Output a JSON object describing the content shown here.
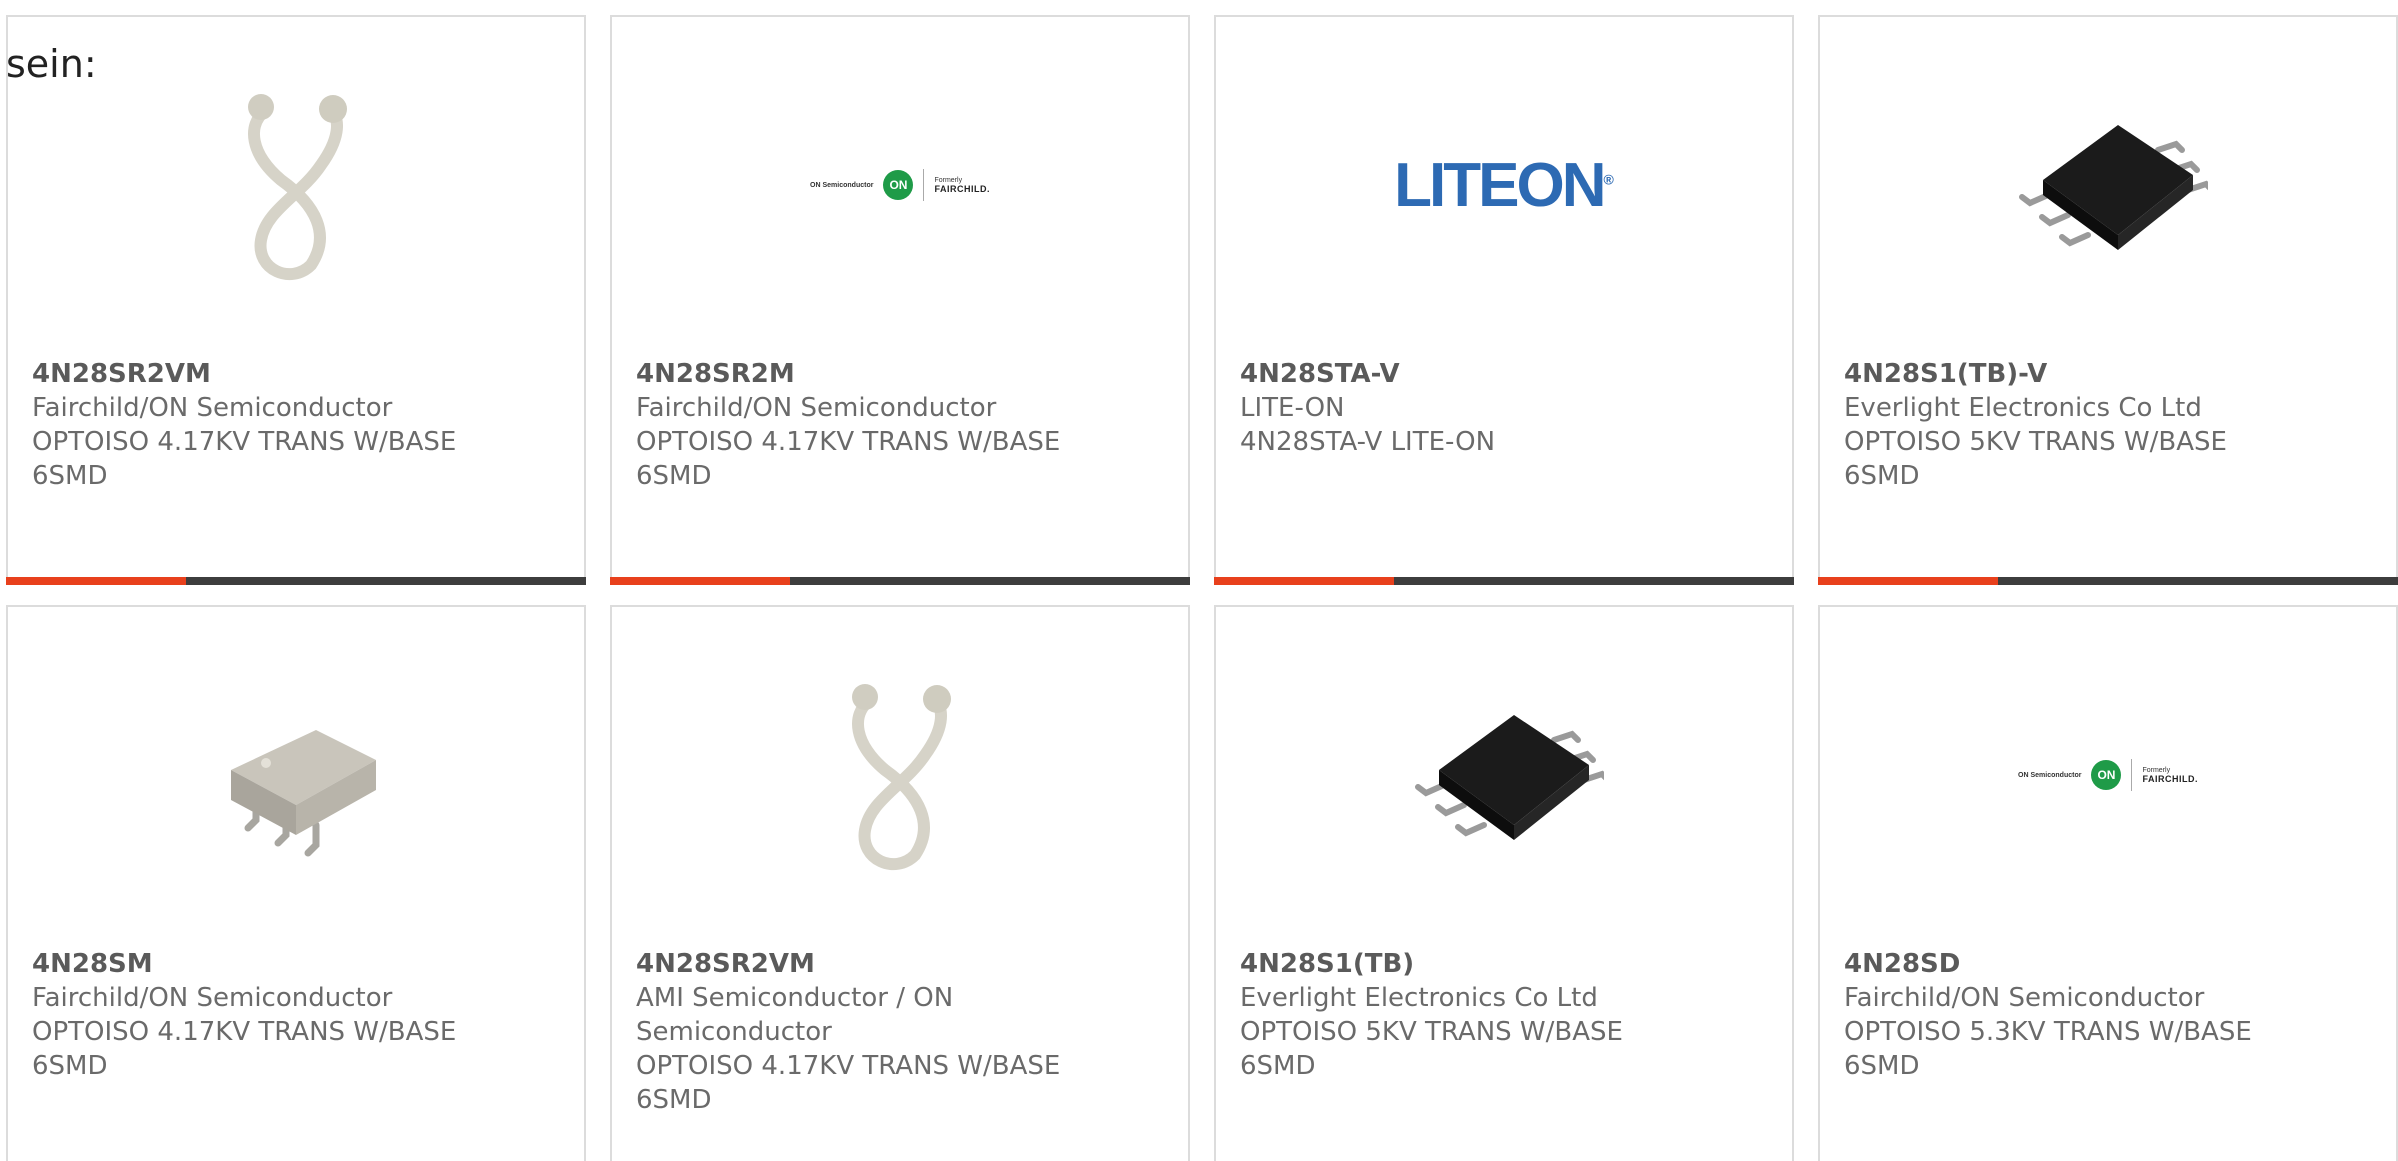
{
  "lead_text": "sein:",
  "colors": {
    "accent": "#e8401c",
    "bar": "#3d3d3d",
    "border": "#dcdcdc"
  },
  "products": [
    {
      "part_number": "4N28SR2VM",
      "manufacturer": "Fairchild/ON Semiconductor",
      "description": "OPTOISO 4.17KV TRANS W/BASE 6SMD",
      "image": "cable-tie-icon"
    },
    {
      "part_number": "4N28SR2M",
      "manufacturer": "Fairchild/ON Semiconductor",
      "description": "OPTOISO 4.17KV TRANS W/BASE 6SMD",
      "image": "on-fairchild-logo",
      "logo": {
        "on_text": "ON Semiconductor",
        "on_badge": "ON",
        "formerly": "Formerly",
        "fairchild": "FAIRCHILD."
      }
    },
    {
      "part_number": "4N28STA-V",
      "manufacturer": "LITE-ON",
      "description": "4N28STA-V LITE-ON",
      "image": "liteon-logo",
      "logo": {
        "text": "LITEON",
        "mark": "®"
      }
    },
    {
      "part_number": "4N28S1(TB)-V",
      "manufacturer": "Everlight Electronics Co Ltd",
      "description": "OPTOISO 5KV TRANS W/BASE 6SMD",
      "image": "black-smd-chip-icon"
    },
    {
      "part_number": "4N28SM",
      "manufacturer": "Fairchild/ON Semiconductor",
      "description": "OPTOISO 4.17KV TRANS W/BASE 6SMD",
      "image": "gray-smd-chip-icon"
    },
    {
      "part_number": "4N28SR2VM",
      "manufacturer": "AMI Semiconductor / ON Semiconductor",
      "description": "OPTOISO 4.17KV TRANS W/BASE 6SMD",
      "image": "cable-tie-icon"
    },
    {
      "part_number": "4N28S1(TB)",
      "manufacturer": "Everlight Electronics Co Ltd",
      "description": "OPTOISO 5KV TRANS W/BASE 6SMD",
      "image": "black-smd-chip-icon"
    },
    {
      "part_number": "4N28SD",
      "manufacturer": "Fairchild/ON Semiconductor",
      "description": "OPTOISO 5.3KV TRANS W/BASE 6SMD",
      "image": "on-fairchild-logo",
      "logo": {
        "on_text": "ON Semiconductor",
        "on_badge": "ON",
        "formerly": "Formerly",
        "fairchild": "FAIRCHILD."
      }
    }
  ],
  "progress_fraction": 0.31
}
